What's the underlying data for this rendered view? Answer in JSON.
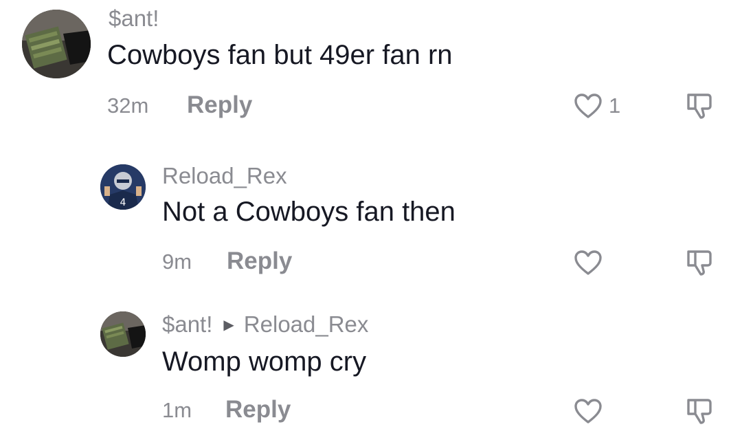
{
  "comments": [
    {
      "username": "$ant!",
      "text": "Cowboys fan but 49er fan rn",
      "time": "32m",
      "reply_label": "Reply",
      "like_count": "1"
    },
    {
      "username": "Reload_Rex",
      "text": "Not a Cowboys fan then",
      "time": "9m",
      "reply_label": "Reply"
    },
    {
      "username": "$ant!",
      "reply_to": "Reload_Rex",
      "text": "Womp womp cry",
      "time": "1m",
      "reply_label": "Reply"
    }
  ],
  "icons": {
    "like": "heart-outline-icon",
    "dislike": "thumbs-down-outline-icon",
    "reply_arrow": "triangle-right-icon"
  },
  "colors": {
    "primary_text": "#161823",
    "secondary_text": "#8a8b91",
    "icon_stroke": "#8a8b91"
  }
}
